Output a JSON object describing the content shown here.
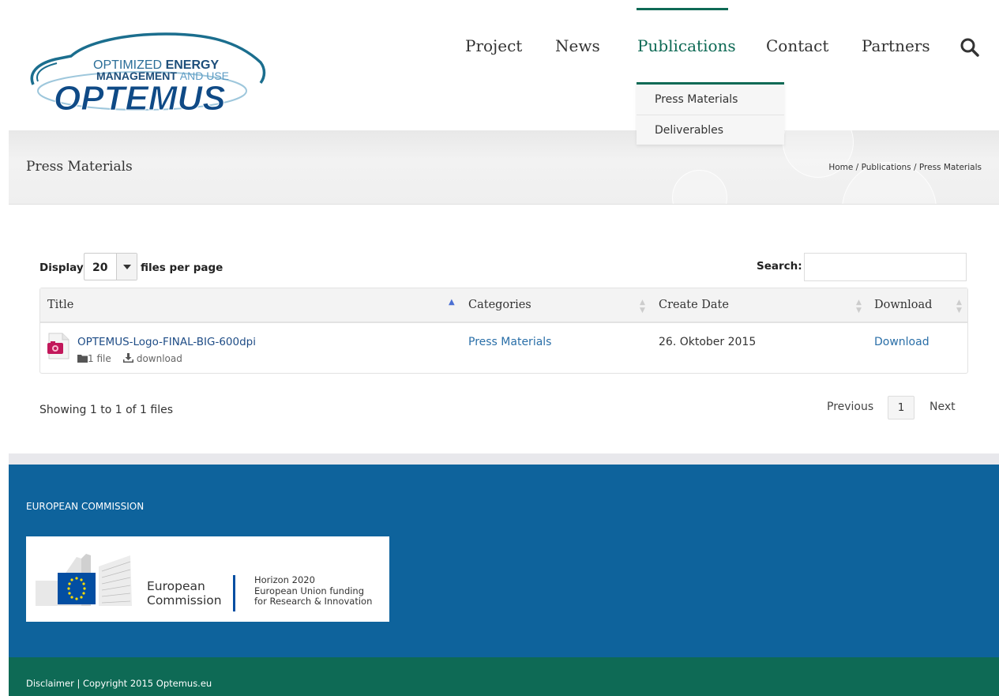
{
  "header": {
    "logo": {
      "line1_a": "OPTIMIZED ",
      "line1_b": "ENERGY",
      "line2_a": "MANAGEMENT ",
      "line2_b": "AND USE",
      "brand": "OPTEMUS"
    },
    "nav": [
      {
        "label": "Project"
      },
      {
        "label": "News"
      },
      {
        "label": "Publications"
      },
      {
        "label": "Contact"
      },
      {
        "label": "Partners"
      }
    ],
    "active_color": "#0e6a55",
    "search_icon": "search-icon"
  },
  "dropdown": {
    "items": [
      "Press Materials",
      "Deliverables"
    ]
  },
  "titlebar": {
    "title": "Press Materials",
    "breadcrumb": [
      "Home",
      "Publications",
      "Press Materials"
    ],
    "separator": "/"
  },
  "table_controls": {
    "display_label": "Display",
    "per_page_value": "20",
    "files_label": "files per page",
    "search_label": "Search:",
    "search_value": ""
  },
  "table": {
    "columns": [
      "Title",
      "Categories",
      "Create Date",
      "Download"
    ],
    "rows": [
      {
        "title": "OPTEMUS-Logo-FINAL-BIG-600dpi",
        "files": "1 file",
        "download_meta": "download",
        "category": "Press Materials",
        "date": "26. Oktober 2015",
        "download": "Download"
      }
    ]
  },
  "pagination": {
    "info": "Showing 1 to 1 of 1 files",
    "previous": "Previous",
    "page": "1",
    "next": "Next"
  },
  "footer": {
    "heading": "EUROPEAN COMMISSION",
    "ec_line1": "European",
    "ec_line2": "Commission",
    "h2020_line1": "Horizon 2020",
    "h2020_line2": "European Union funding",
    "h2020_line3": "for Research & Innovation",
    "bottom": "Disclaimer | Copyright 2015 Optemus.eu",
    "colors": {
      "footer": "#0e639c",
      "bottom": "#0e6a55"
    }
  }
}
